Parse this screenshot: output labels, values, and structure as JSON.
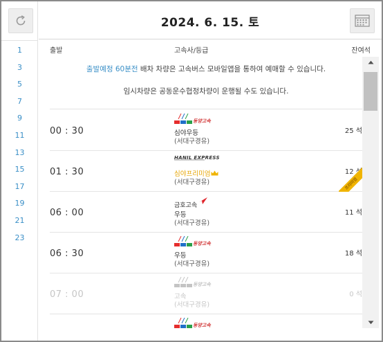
{
  "header": {
    "date": "2024. 6. 15. 토"
  },
  "sidebar": {
    "hours": [
      "1",
      "3",
      "5",
      "7",
      "9",
      "11",
      "13",
      "15",
      "17",
      "19",
      "21",
      "23"
    ]
  },
  "columns": {
    "departure": "출발",
    "company": "고속사/등급",
    "seats": "잔여석"
  },
  "notice": {
    "highlight": "출발예정 60분전",
    "line1_rest": " 배차 차량은 고속버스 모바일앱을 통하여 예매할 수 있습니다.",
    "line2": "임시차량은 공동운수협정차량이 운행될 수도 있습니다."
  },
  "rows": [
    {
      "time": "00 : 30",
      "company": "동양고속",
      "grade": "심야우등",
      "route": "(서대구경유)",
      "seats": "25 석",
      "disabled": false,
      "premium": false
    },
    {
      "time": "01 : 30",
      "company": "HANIL EXPRESS",
      "grade": "심야프리미엄",
      "route": "(서대구경유)",
      "seats": "12 석",
      "disabled": false,
      "premium": true,
      "ribbon": "프리미엄"
    },
    {
      "time": "06 : 00",
      "company": "금호고속",
      "grade": "우등",
      "route": "(서대구경유)",
      "seats": "11 석",
      "disabled": false,
      "premium": false
    },
    {
      "time": "06 : 30",
      "company": "동양고속",
      "grade": "우등",
      "route": "(서대구경유)",
      "seats": "18 석",
      "disabled": false,
      "premium": false
    },
    {
      "time": "07 : 00",
      "company": "동양고속",
      "grade": "고속",
      "route": "(서대구경유)",
      "seats": "0 석",
      "disabled": true,
      "premium": false
    },
    {
      "time": "",
      "company": "동양고속",
      "grade": "",
      "route": "",
      "seats": "",
      "disabled": false,
      "premium": false
    }
  ],
  "colors": {
    "accent": "#3a8fc7",
    "premium": "#f0b400",
    "dongyang_red": "#e52d2d",
    "dongyang_blue": "#1f6fc8",
    "dongyang_green": "#2aa14a",
    "kumho_red": "#e0242b"
  }
}
